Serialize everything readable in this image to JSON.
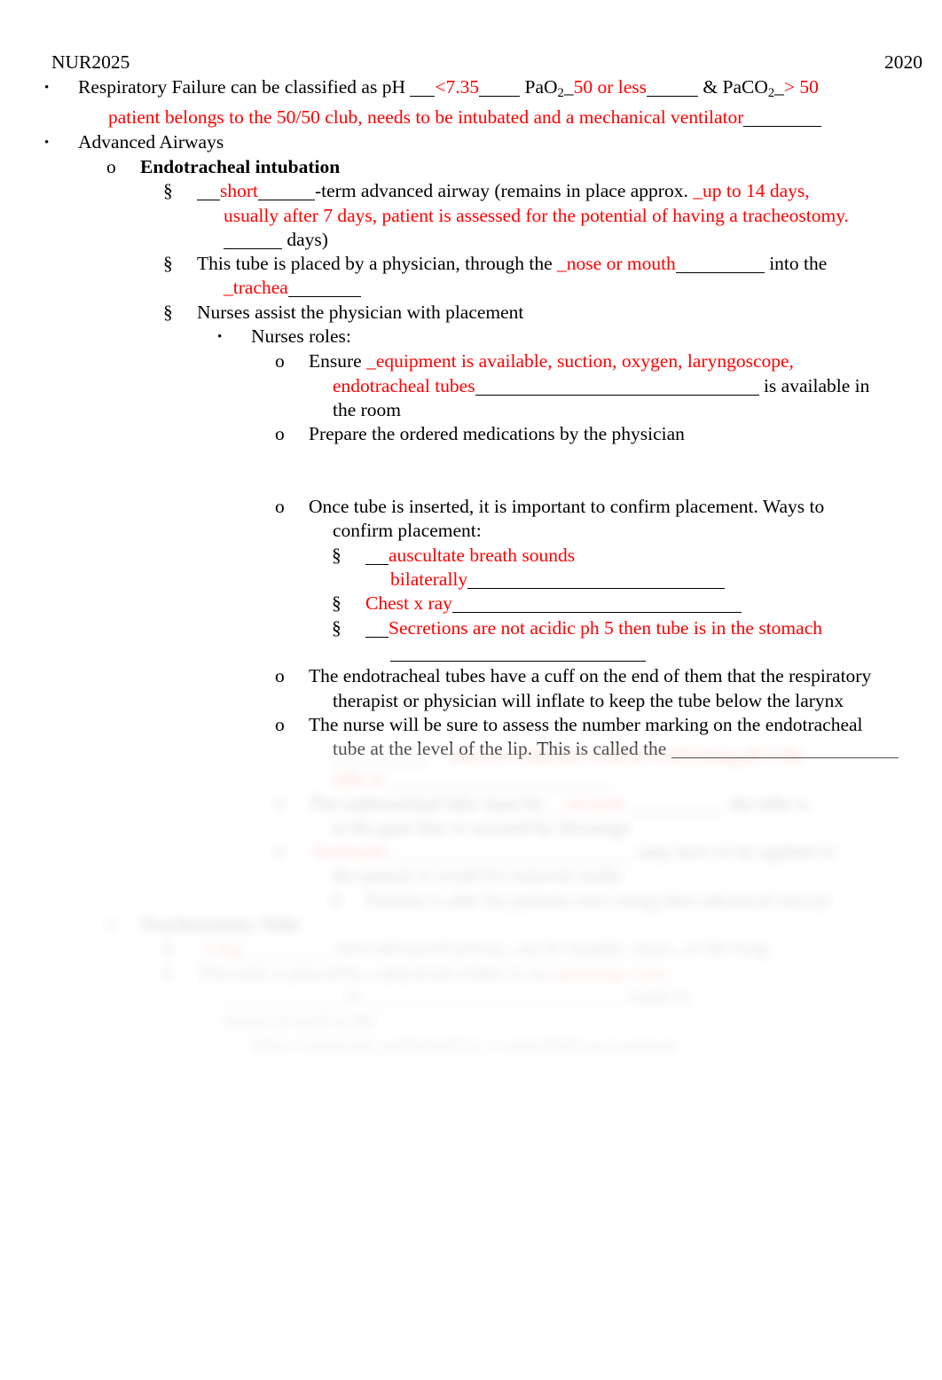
{
  "document": {
    "header": {
      "course_code": "NUR2025",
      "year": "2020"
    },
    "markers": {
      "bullet": "•",
      "circle": "o",
      "section": "§"
    },
    "colors": {
      "text": "#000000",
      "answer": "#ff0000",
      "page_background": "#ffffff"
    },
    "content": {
      "resp_failure": {
        "marker": "•",
        "lead": "Respiratory Failure can be classified as  pH ",
        "blank1": "___",
        "answer_ph": "<7.35",
        "blank2": "_____",
        "label_pao2": "PaO",
        "label_pao2_sub": "2",
        "answer_pao2_prefix": "_",
        "answer_pao2": "50 or less",
        "blank3": "______",
        "amp": "& ",
        "label_paco2": "PaCO",
        "label_paco2_sub": "2",
        "answer_paco2_prefix": "_",
        "answer_paco2": "> 50",
        "answer_line2": "patient belongs to the 50/50 club, needs to be intubated and a mechanical ventilator",
        "blank4": "_______"
      },
      "advanced_airways": {
        "marker": "•",
        "text": "Advanced Airways"
      },
      "endotracheal_intubation": {
        "marker": "o",
        "text": "Endotracheal intubation"
      },
      "short_term": {
        "marker": "§",
        "blank_pre": "___",
        "answer_short": "short",
        "blank_post": "_______",
        "text_a": "-term advanced airway (remains in place approx.",
        "answer_days_1": "_up to 14 days,",
        "answer_days_2": "usually after 7 days, patient is assessed for the potential of having a tracheostomy.",
        "blank_days": "_______",
        "text_b": "days)"
      },
      "tube_placed": {
        "marker": "§",
        "text_a": "This tube is placed by a physician, through the",
        "answer_route": "_nose or mouth",
        "blank_route": "__________",
        "text_b": "into the",
        "answer_trachea": "_trachea",
        "blank_trachea": "_________"
      },
      "nurses_assist": {
        "marker": "§",
        "text": "Nurses assist the physician with placement"
      },
      "nurses_roles": {
        "marker": "•",
        "text": "Nurses roles:"
      },
      "ensure_equipment": {
        "marker": "o",
        "text_a": "Ensure",
        "answer_line1": "_equipment is available, suction, oxygen, laryngoscope,",
        "answer_line2": "endotracheal tubes",
        "blank": "_______________________________",
        "text_b": "is available in",
        "text_c": "the room"
      },
      "prepare_meds": {
        "marker": "o",
        "text": "Prepare the ordered medications by the physician"
      },
      "confirm_placement": {
        "marker": "o",
        "text_a": "Once tube is inserted, it is important to confirm placement. Ways to",
        "text_b": "confirm placement:"
      },
      "confirm_auscultate": {
        "marker": "§",
        "blank_pre": "___",
        "answer_line1": "auscultate breath sounds",
        "answer_line2": "bilaterally",
        "blank_post": "_____________________________"
      },
      "confirm_xray": {
        "marker": "§",
        "answer": "Chest x ray",
        "blank": "______________________________"
      },
      "confirm_secretions": {
        "marker": "§",
        "blank_pre": "___",
        "answer": "Secretions are not acidic ph 5 then tube is in the stomach",
        "blank_post": "___________________________"
      },
      "cuff": {
        "marker": "o",
        "text_a": "The endotracheal tubes have a cuff on the end of them that the respiratory",
        "text_b": "therapist or physician will inflate to keep the tube below the larynx"
      },
      "lip_marking": {
        "marker": "o",
        "text_a": "The nurse will be sure to assess the number marking on the endotracheal",
        "text_b": "tube at the level of the lip. This is called the",
        "blank": "_______________________"
      }
    },
    "obscured_tail": {
      "note": "remaining page content is blurred out",
      "lines": [
        {
          "indent": "cont4",
          "marker": "",
          "black": "",
          "blank": "____________",
          "red": ""
        },
        {
          "indent": "lvl4",
          "marker": "o",
          "black": "",
          "blank": "___________",
          "red": ""
        },
        {
          "indent": "cont4",
          "marker": "",
          "black": "",
          "blank": "",
          "red": ""
        },
        {
          "indent": "lvl4",
          "marker": "o",
          "black": "",
          "blank": "______________________________",
          "red": ""
        },
        {
          "indent": "cont4",
          "marker": "",
          "black": "",
          "blank": "",
          "red": ""
        },
        {
          "indent": "lvl5",
          "marker": "§",
          "black": "",
          "blank": "",
          "red": ""
        },
        {
          "indent": "lvl2",
          "marker": "o",
          "black": "",
          "blank": "",
          "red": ""
        },
        {
          "indent": "lvl3",
          "marker": "§",
          "black": "",
          "blank": "__________",
          "red": ""
        },
        {
          "indent": "lvl3",
          "marker": "§",
          "black": "",
          "blank": "",
          "red": ""
        },
        {
          "indent": "cont3",
          "marker": "",
          "black": "",
          "blank": "_______________________________",
          "red": ""
        },
        {
          "indent": "cont3",
          "marker": "",
          "black": "",
          "blank": "",
          "red": ""
        },
        {
          "indent": "lvl4",
          "marker": "•",
          "black": "",
          "blank": "",
          "red": ""
        }
      ]
    }
  }
}
